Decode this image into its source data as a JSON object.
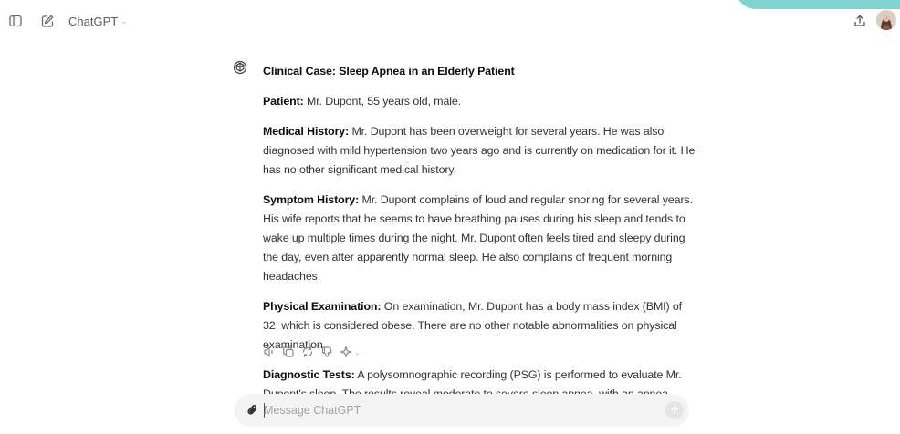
{
  "header": {
    "model_name": "ChatGPT"
  },
  "message": {
    "title": "Clinical Case: Sleep Apnea in an Elderly Patient",
    "paragraphs": [
      {
        "label": "Patient:",
        "text": " Mr. Dupont, 55 years old, male."
      },
      {
        "label": "Medical History:",
        "text": " Mr. Dupont has been overweight for several years. He was also diagnosed with mild hypertension two years ago and is currently on medication for it. He has no other significant medical history."
      },
      {
        "label": "Symptom History:",
        "text": " Mr. Dupont complains of loud and regular snoring for several years. His wife reports that he seems to have breathing pauses during his sleep and tends to wake up multiple times during the night. Mr. Dupont often feels tired and sleepy during the day, even after apparently normal sleep. He also complains of frequent morning headaches."
      },
      {
        "label": "Physical Examination:",
        "text": " On examination, Mr. Dupont has a body mass index (BMI) of 32, which is considered obese. There are no other notable abnormalities on physical examination."
      },
      {
        "label": "Diagnostic Tests:",
        "text": " A polysomnographic recording (PSG) is performed to evaluate Mr. Dupont's sleep. The results reveal moderate to severe sleep apnea, with an apnea index"
      }
    ]
  },
  "composer": {
    "placeholder": "Message ChatGPT",
    "value": ""
  },
  "colors": {
    "accent_tab": "#7fd3d1",
    "text": "#0d0d0d",
    "muted": "#5d5d5d",
    "composer_bg": "#f4f4f4"
  },
  "icons": {
    "sidebar_toggle": "sidebar-icon",
    "new_chat": "edit-icon",
    "share": "share-icon",
    "read_aloud": "speaker-icon",
    "copy": "copy-icon",
    "regenerate": "refresh-icon",
    "dislike": "thumbs-down-icon",
    "change_model": "sparkle-icon",
    "attach": "paperclip-icon",
    "send": "arrow-up-icon"
  }
}
